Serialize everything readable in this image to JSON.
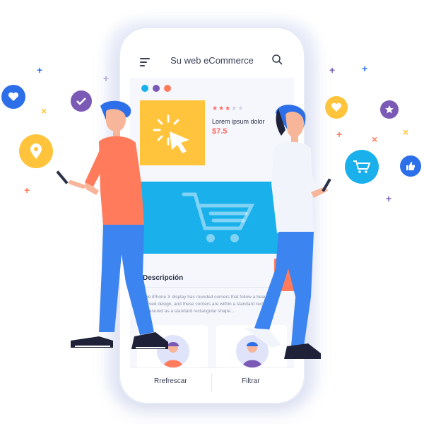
{
  "app": {
    "title": "Su web eCommerce"
  },
  "product": {
    "name": "Lorem ipsum dolor",
    "price": "$7.5",
    "rating": 3,
    "rating_max": 5
  },
  "description": {
    "heading": "Descripción",
    "body": "The iPhone X display has rounded corners that follow a beautiful curved design, and these corners are within a standard rectangle. measured as a standard rectangular shape..."
  },
  "bottom_bar": {
    "refresh_label": "Rrefrescar",
    "filter_label": "Filtrar"
  },
  "colors": {
    "accent_blue": "#19b0ec",
    "accent_yellow": "#ffc43b",
    "price_red": "#ff6a6a",
    "shirt_orange": "#ff7b5c",
    "pants_blue": "#3c84f0",
    "purple": "#7b5ab5"
  },
  "icons": {
    "menu": "menu-icon",
    "search": "search-icon",
    "cart": "cart-icon",
    "click": "click-icon",
    "heart": "heart-icon",
    "check": "check-icon",
    "location": "location-pin-icon",
    "star": "star-icon",
    "like": "thumbs-up-icon"
  }
}
